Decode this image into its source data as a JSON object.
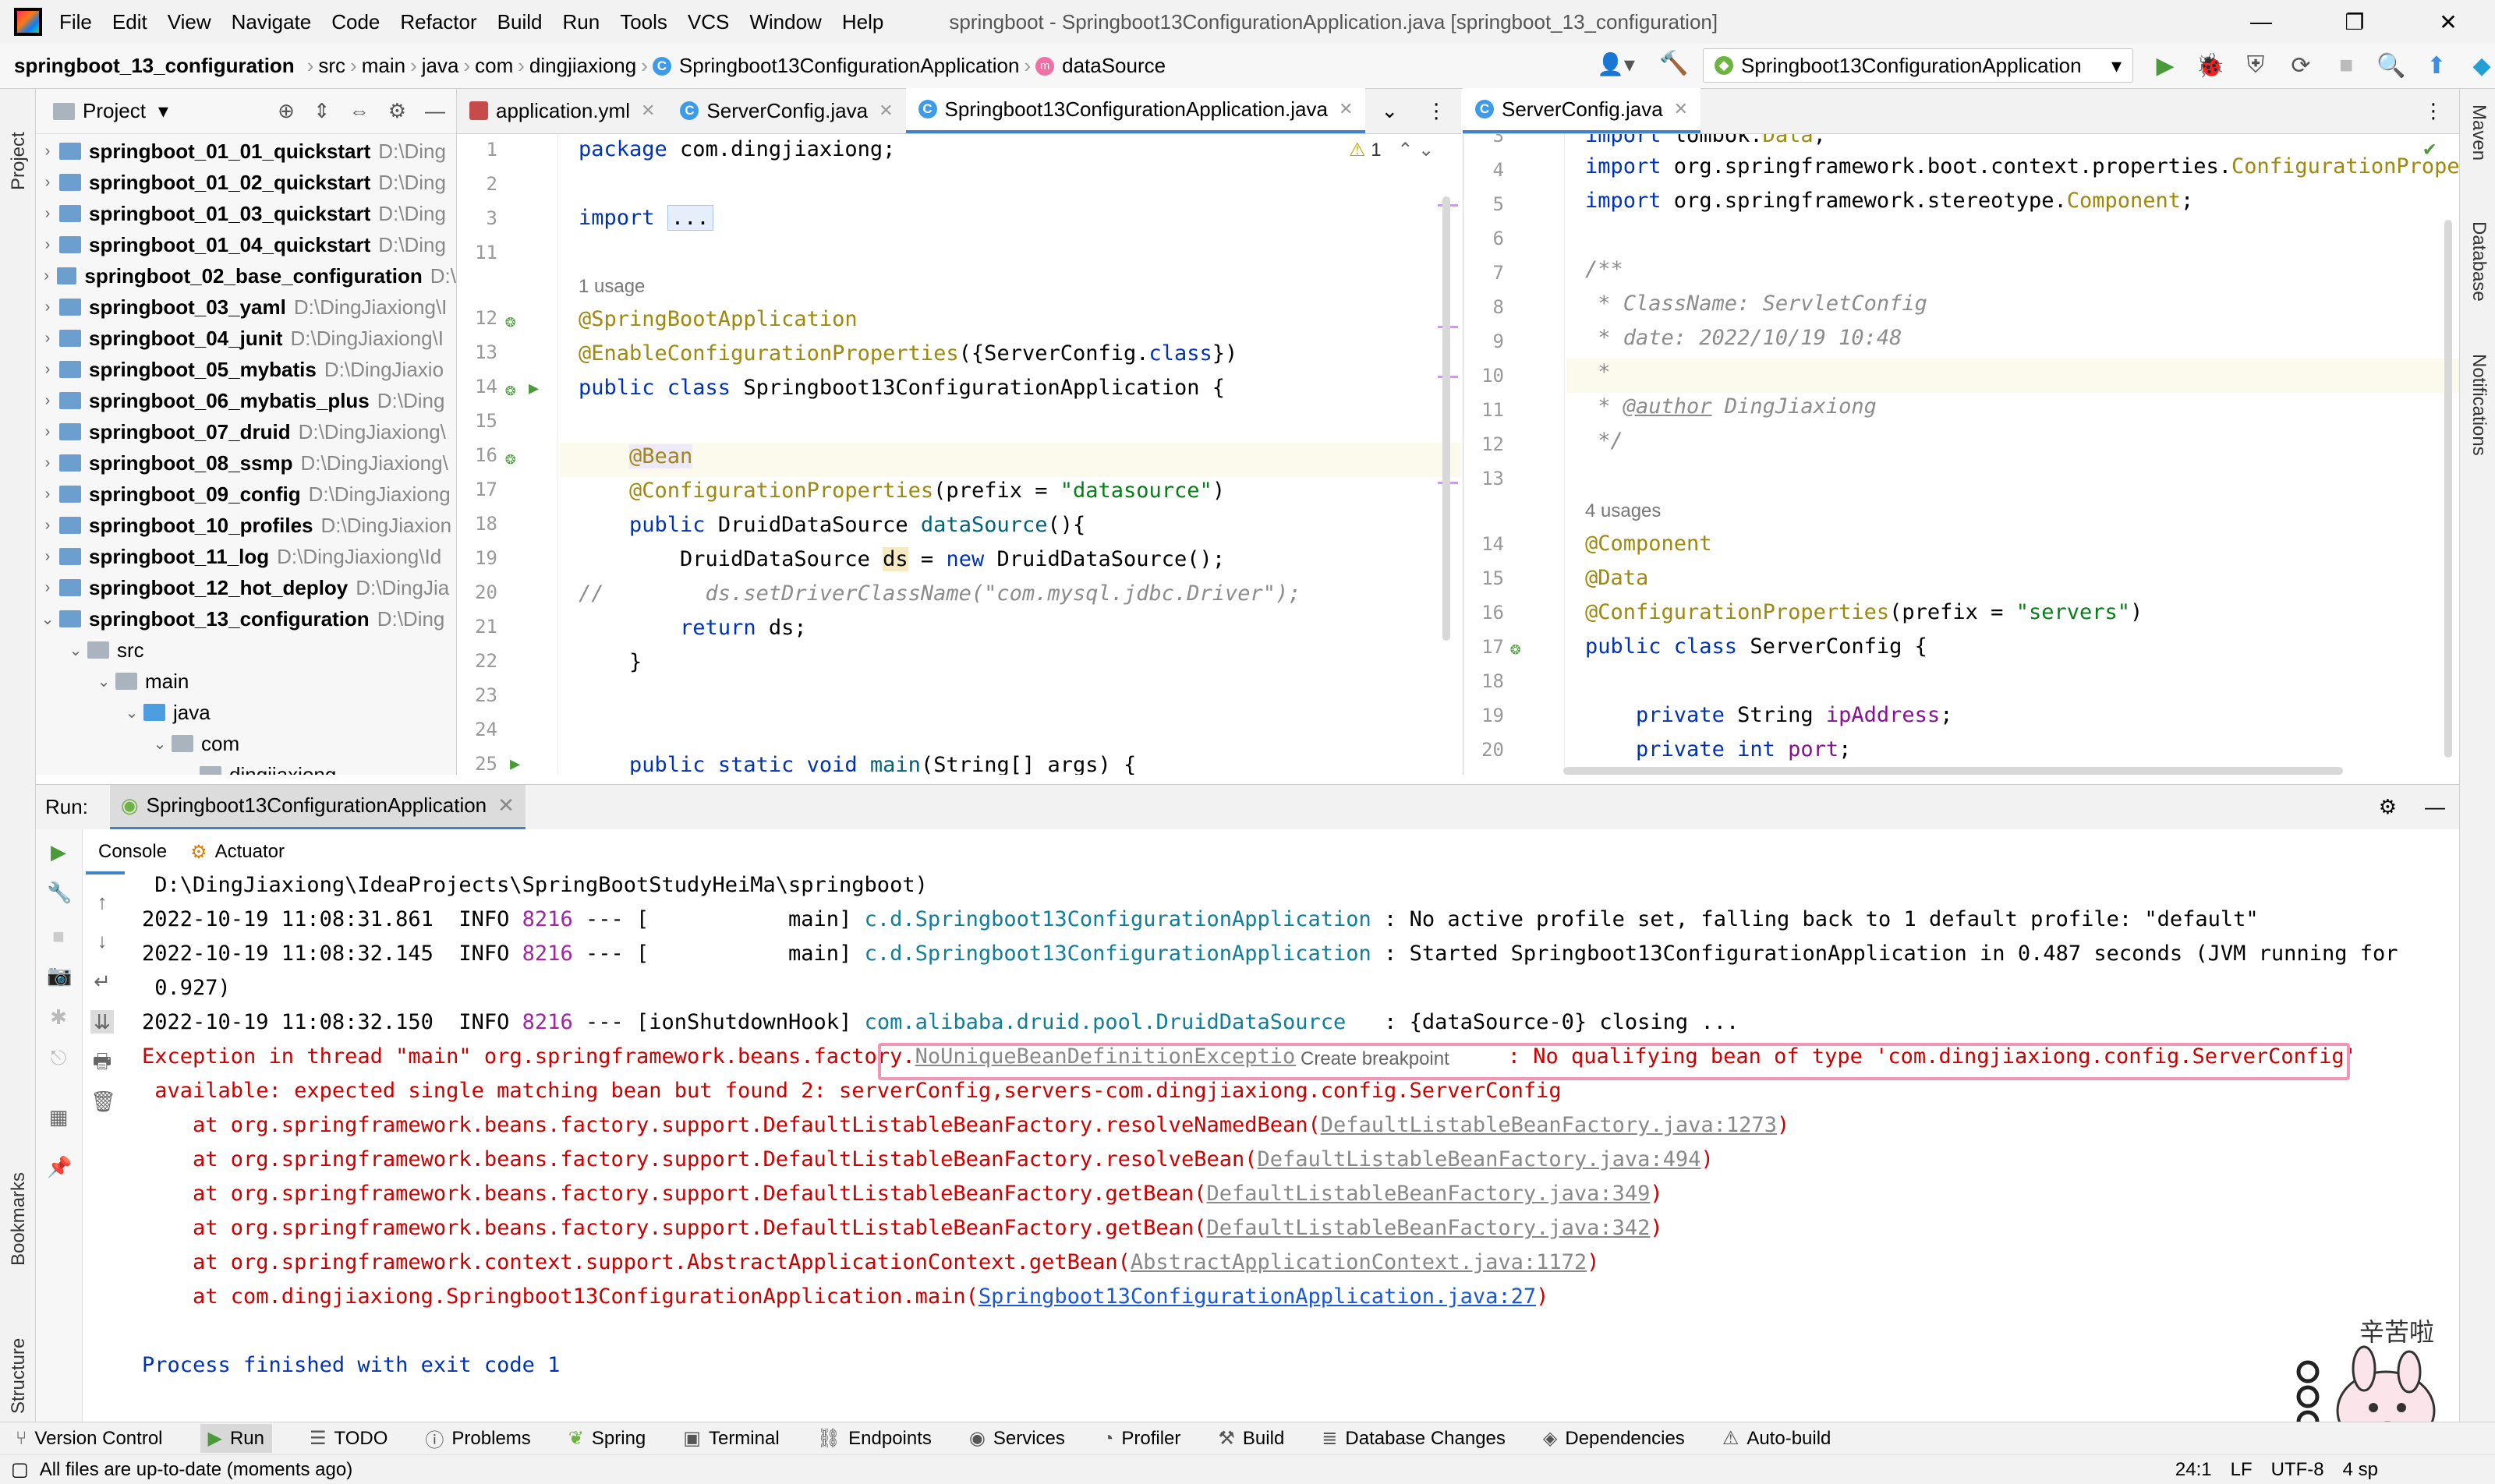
{
  "menu": {
    "items": [
      "File",
      "Edit",
      "View",
      "Navigate",
      "Code",
      "Refactor",
      "Build",
      "Run",
      "Tools",
      "VCS",
      "Window",
      "Help"
    ],
    "title": "springboot - Springboot13ConfigurationApplication.java [springboot_13_configuration]"
  },
  "breadcrumb": [
    "springboot_13_configuration",
    "src",
    "main",
    "java",
    "com",
    "dingjiaxiong",
    "Springboot13ConfigurationApplication",
    "dataSource"
  ],
  "run_config": "Springboot13ConfigurationApplication",
  "side_labels": {
    "project": "Project",
    "bookmarks": "Bookmarks",
    "structure": "Structure",
    "maven": "Maven",
    "database": "Database",
    "notifications": "Notifications"
  },
  "project": {
    "header": "Project",
    "items": [
      {
        "name": "springboot_01_01_quickstart",
        "path": "D:\\Ding"
      },
      {
        "name": "springboot_01_02_quickstart",
        "path": "D:\\Ding"
      },
      {
        "name": "springboot_01_03_quickstart",
        "path": "D:\\Ding"
      },
      {
        "name": "springboot_01_04_quickstart",
        "path": "D:\\Ding"
      },
      {
        "name": "springboot_02_base_configuration",
        "path": "D:\\"
      },
      {
        "name": "springboot_03_yaml",
        "path": "D:\\DingJiaxiong\\I"
      },
      {
        "name": "springboot_04_junit",
        "path": "D:\\DingJiaxiong\\I"
      },
      {
        "name": "springboot_05_mybatis",
        "path": "D:\\DingJiaxio"
      },
      {
        "name": "springboot_06_mybatis_plus",
        "path": "D:\\Ding"
      },
      {
        "name": "springboot_07_druid",
        "path": "D:\\DingJiaxiong\\"
      },
      {
        "name": "springboot_08_ssmp",
        "path": "D:\\DingJiaxiong\\"
      },
      {
        "name": "springboot_09_config",
        "path": "D:\\DingJiaxiong"
      },
      {
        "name": "springboot_10_profiles",
        "path": "D:\\DingJiaxion"
      },
      {
        "name": "springboot_11_log",
        "path": "D:\\DingJiaxiong\\Id"
      },
      {
        "name": "springboot_12_hot_deploy",
        "path": "D:\\DingJia"
      },
      {
        "name": "springboot_13_configuration",
        "path": "D:\\Ding"
      }
    ],
    "sub": [
      "src",
      "main",
      "java",
      "com",
      "dingjiaxiong"
    ]
  },
  "editor1": {
    "tabs": [
      "application.yml",
      "ServerConfig.java",
      "Springboot13ConfigurationApplication.java"
    ],
    "warn_count": "1",
    "usage": "1 usage",
    "line_numbers": [
      "1",
      "2",
      "3",
      "11",
      "",
      "12",
      "13",
      "14",
      "15",
      "16",
      "17",
      "18",
      "19",
      "20",
      "21",
      "22",
      "23",
      "24",
      "25"
    ]
  },
  "editor2": {
    "tab": "ServerConfig.java",
    "usage": "4 usages",
    "line_numbers": [
      "3",
      "4",
      "5",
      "6",
      "7",
      "8",
      "9",
      "10",
      "11",
      "12",
      "13",
      "",
      "14",
      "15",
      "16",
      "17",
      "18",
      "19",
      "20"
    ]
  },
  "run": {
    "label": "Run:",
    "config": "Springboot13ConfigurationApplication",
    "tabs": [
      "Console",
      "Actuator"
    ],
    "lines": {
      "l0": " D:\\DingJiaxiong\\IdeaProjects\\SpringBootStudyHeiMa\\springboot)",
      "l1_ts": "2022-10-19 11:08:31.861  INFO ",
      "l1_pid": "8216",
      "l1_mid": " --- [           main] ",
      "l1_cls": "c.d.Springboot13ConfigurationApplication",
      "l1_msg": " : No active profile set, falling back to 1 default profile: \"default\"",
      "l2_ts": "2022-10-19 11:08:32.145  INFO ",
      "l2_pid": "8216",
      "l2_mid": " --- [           main] ",
      "l2_cls": "c.d.Springboot13ConfigurationApplication",
      "l2_msg": " : Started Springboot13ConfigurationApplication in 0.487 seconds (JVM running for",
      "l3": " 0.927)",
      "l4_ts": "2022-10-19 11:08:32.150  INFO ",
      "l4_pid": "8216",
      "l4_mid": " --- [ionShutdownHook] ",
      "l4_cls": "com.alibaba.druid.pool.DruidDataSource",
      "l4_msg": "   : {dataSource-0} closing ...",
      "e1a": "Exception in thread \"main\" org.springframework.beans.factory.",
      "e1link": "NoUniqueBeanDefinitionException",
      "e1tip": "Create breakpoint",
      "e1b": " : No qualifying bean of type 'com.dingjiaxiong.config.ServerConfig'",
      "e2": " available: expected single matching bean but found 2: serverConfig,servers-com.dingjiaxiong.config.ServerConfig",
      "s1a": "    at org.springframework.beans.factory.support.DefaultListableBeanFactory.resolveNamedBean(",
      "s1l": "DefaultListableBeanFactory.java:1273",
      "s2a": "    at org.springframework.beans.factory.support.DefaultListableBeanFactory.resolveBean(",
      "s2l": "DefaultListableBeanFactory.java:494",
      "s3a": "    at org.springframework.beans.factory.support.DefaultListableBeanFactory.getBean(",
      "s3l": "DefaultListableBeanFactory.java:349",
      "s4a": "    at org.springframework.beans.factory.support.DefaultListableBeanFactory.getBean(",
      "s4l": "DefaultListableBeanFactory.java:342",
      "s5a": "    at org.springframework.context.support.AbstractApplicationContext.getBean(",
      "s5l": "AbstractApplicationContext.java:1172",
      "s6a": "    at com.dingjiaxiong.Springboot13ConfigurationApplication.main(",
      "s6l": "Springboot13ConfigurationApplication.java:27",
      "close": ")",
      "proc": "Process finished with exit code 1"
    }
  },
  "toolwindows": [
    "Version Control",
    "Run",
    "TODO",
    "Problems",
    "Spring",
    "Terminal",
    "Endpoints",
    "Services",
    "Profiler",
    "Build",
    "Database Changes",
    "Dependencies",
    "Auto-build"
  ],
  "status": {
    "message": "All files are up-to-date (moments ago)",
    "pos": "24:1",
    "lf": "LF",
    "enc": "UTF-8",
    "indent": "4 sp"
  },
  "sticker_text": "辛苦啦",
  "colors": {
    "accent": "#4083c9",
    "error": "#cc0000",
    "highlight": "#f095b5"
  }
}
